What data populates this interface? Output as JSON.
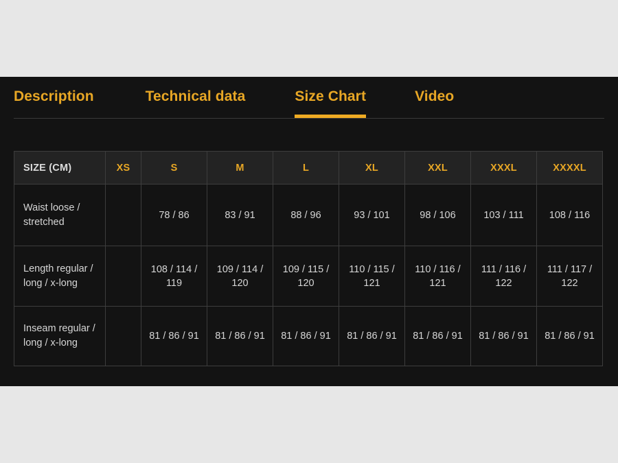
{
  "tabs": [
    {
      "label": "Description",
      "active": false
    },
    {
      "label": "Technical data",
      "active": false
    },
    {
      "label": "Size Chart",
      "active": true
    },
    {
      "label": "Video",
      "active": false
    }
  ],
  "size_table": {
    "row_header_label": "SIZE (CM)",
    "columns": [
      "XS",
      "S",
      "M",
      "L",
      "XL",
      "XXL",
      "XXXL",
      "XXXXL"
    ],
    "rows": [
      {
        "label": "Waist loose / stretched",
        "values": [
          "",
          "78 / 86",
          "83 / 91",
          "88 / 96",
          "93 / 101",
          "98 / 106",
          "103 / 111",
          "108 / 116"
        ]
      },
      {
        "label": "Length regular / long / x-long",
        "values": [
          "",
          "108 / 114 / 119",
          "109 / 114 / 120",
          "109 / 115 / 120",
          "110 / 115 / 121",
          "110 / 116 / 121",
          "111 / 116 / 122",
          "111 / 117 / 122"
        ]
      },
      {
        "label": "Inseam regular / long / x-long",
        "values": [
          "",
          "81 / 86 / 91",
          "81 / 86 / 91",
          "81 / 86 / 91",
          "81 / 86 / 91",
          "81 / 86 / 91",
          "81 / 86 / 91",
          "81 / 86 / 91"
        ]
      }
    ]
  },
  "colors": {
    "accent": "#e8a725",
    "active_underline": "#eeab23",
    "panel_background": "#131313",
    "page_background": "#e7e7e7",
    "header_cell_background": "#232323",
    "cell_border": "#3d3d3d",
    "body_text": "#d6d6d6"
  }
}
